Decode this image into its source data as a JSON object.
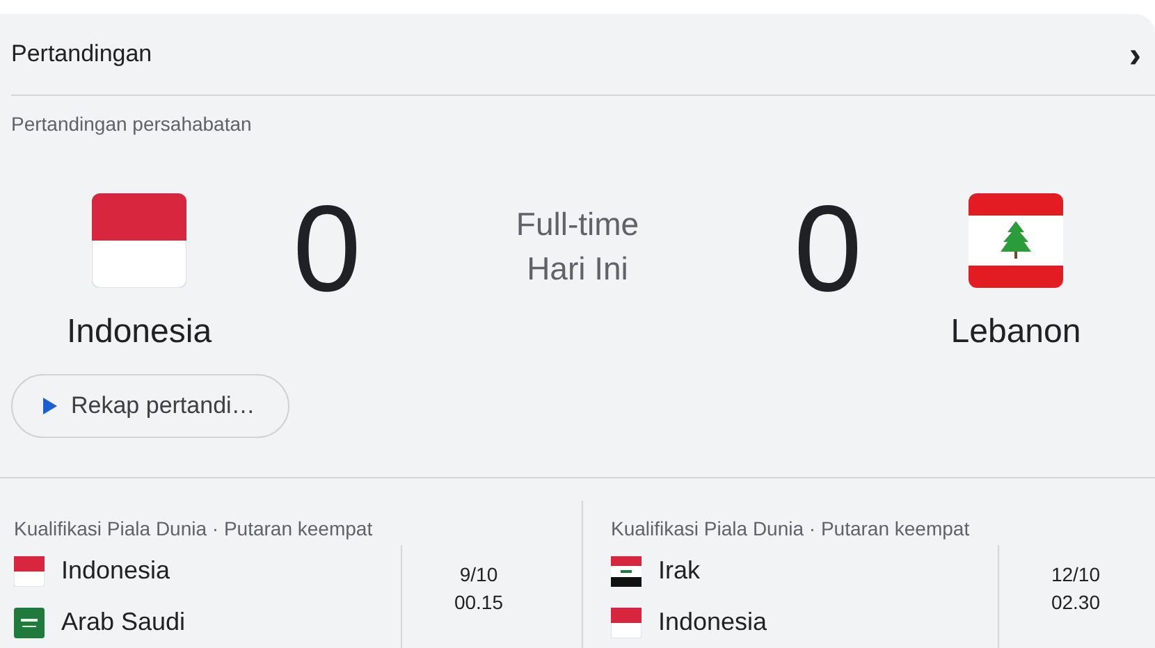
{
  "header": {
    "title": "Pertandingan",
    "chevron": "›"
  },
  "match": {
    "competition": "Pertandingan persahabatan",
    "home": {
      "name": "Indonesia",
      "score": "0",
      "kind": "id"
    },
    "away": {
      "name": "Lebanon",
      "score": "0",
      "kind": "lb"
    },
    "status": "Full-time",
    "day": "Hari Ini",
    "recap_button": "Rekap pertandi…"
  },
  "upcoming": [
    {
      "competition": "Kualifikasi Piala Dunia · Putaran keempat",
      "teams": [
        {
          "name": "Indonesia",
          "kind": "id"
        },
        {
          "name": "Arab Saudi",
          "kind": "sa"
        }
      ],
      "date": "9/10",
      "time": "00.15"
    },
    {
      "competition": "Kualifikasi Piala Dunia · Putaran keempat",
      "teams": [
        {
          "name": "Irak",
          "kind": "iq"
        },
        {
          "name": "Indonesia",
          "kind": "id"
        }
      ],
      "date": "12/10",
      "time": "02.30"
    }
  ]
}
